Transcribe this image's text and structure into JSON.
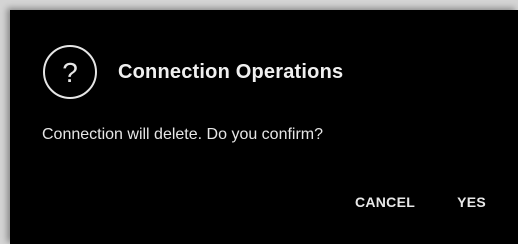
{
  "dialog": {
    "icon": "help-circle-icon",
    "title": "Connection Operations",
    "message": "Connection will delete. Do you confirm?",
    "buttons": {
      "cancel_label": "CANCEL",
      "confirm_label": "YES"
    }
  },
  "colors": {
    "dialog_background": "#000000",
    "text": "#f0f0f0",
    "backdrop": "#d4d4d4"
  }
}
